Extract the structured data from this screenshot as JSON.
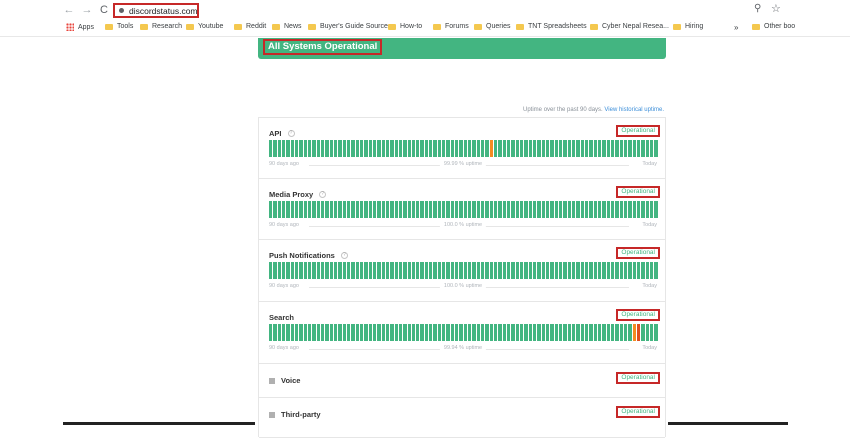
{
  "browser": {
    "url": "discordstatus.com",
    "nav": {
      "back": "←",
      "forward": "→",
      "reload": "C"
    },
    "bookmarks": [
      "Tools",
      "Research",
      "Youtube",
      "Reddit",
      "News",
      "Buyer's Guide Source",
      "How-to",
      "Forums",
      "Queries",
      "TNT Spreadsheets",
      "Cyber Nepal Resea...",
      "Hiring"
    ],
    "apps_label": "Apps",
    "other_label": "Other boo",
    "chevron": "»"
  },
  "banner": {
    "title": "All Systems Operational",
    "color": "#43b581"
  },
  "uptime_note": {
    "text": "Uptime over the past 90 days.",
    "link": "View historical uptime."
  },
  "components": [
    {
      "name": "API",
      "help": "?",
      "status": "Operational",
      "has_bars": true,
      "left": "90 days ago",
      "uptime": "99.99 % uptime",
      "right": "Today",
      "incidents": [
        {
          "day": 51,
          "level": "minor"
        }
      ]
    },
    {
      "name": "Media Proxy",
      "help": "?",
      "status": "Operational",
      "has_bars": true,
      "left": "90 days ago",
      "uptime": "100.0 % uptime",
      "right": "Today",
      "incidents": []
    },
    {
      "name": "Push Notifications",
      "help": "?",
      "status": "Operational",
      "has_bars": true,
      "left": "90 days ago",
      "uptime": "100.0 % uptime",
      "right": "Today",
      "incidents": []
    },
    {
      "name": "Search",
      "help": "",
      "status": "Operational",
      "has_bars": true,
      "left": "90 days ago",
      "uptime": "99.94 % uptime",
      "right": "Today",
      "incidents": [
        {
          "day": 84,
          "level": "minor"
        },
        {
          "day": 85,
          "level": "major"
        }
      ]
    },
    {
      "name": "Voice",
      "help": "",
      "status": "Operational",
      "has_bars": false,
      "expandable": true
    },
    {
      "name": "Third-party",
      "help": "",
      "status": "Operational",
      "has_bars": false,
      "expandable": true
    }
  ],
  "bar_days": 90,
  "colors": {
    "operational": "#43b581",
    "minor": "#f48c22",
    "major": "#e04f1f",
    "highlight": "#c62828"
  }
}
